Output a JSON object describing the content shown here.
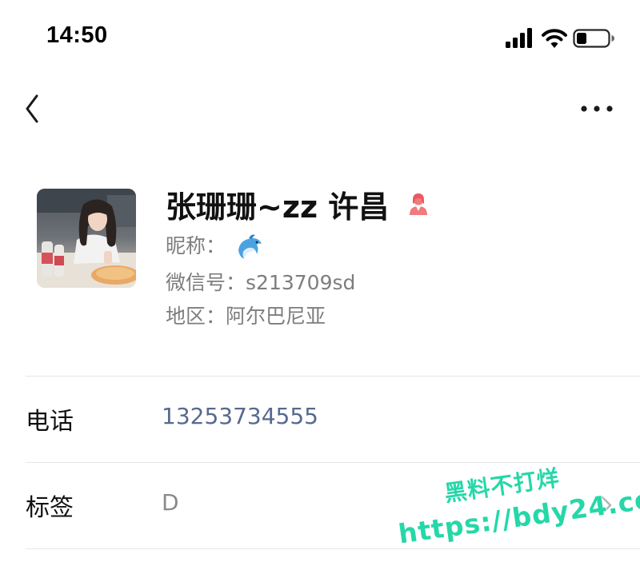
{
  "status_bar": {
    "time": "14:50"
  },
  "nav": {
    "back_icon": "chevron-left-icon",
    "more_icon": "more-dots-icon"
  },
  "profile": {
    "name": "张珊珊~zz 许昌",
    "gender_icon": "female-icon",
    "nickname_label": "昵称：",
    "nickname_icon": "dolphin-emoji",
    "wechat_id_label": "微信号：",
    "wechat_id": "s213709sd",
    "region_label": "地区：",
    "region": "阿尔巴尼亚"
  },
  "rows": {
    "phone": {
      "label": "电话",
      "value": "13253734555",
      "color": "#56698f"
    },
    "tags": {
      "label": "标签",
      "value": "D"
    }
  },
  "watermark": {
    "line1": "黑料不打烊",
    "line2": "https://bdy24.co",
    "color": "#26d7a8"
  }
}
